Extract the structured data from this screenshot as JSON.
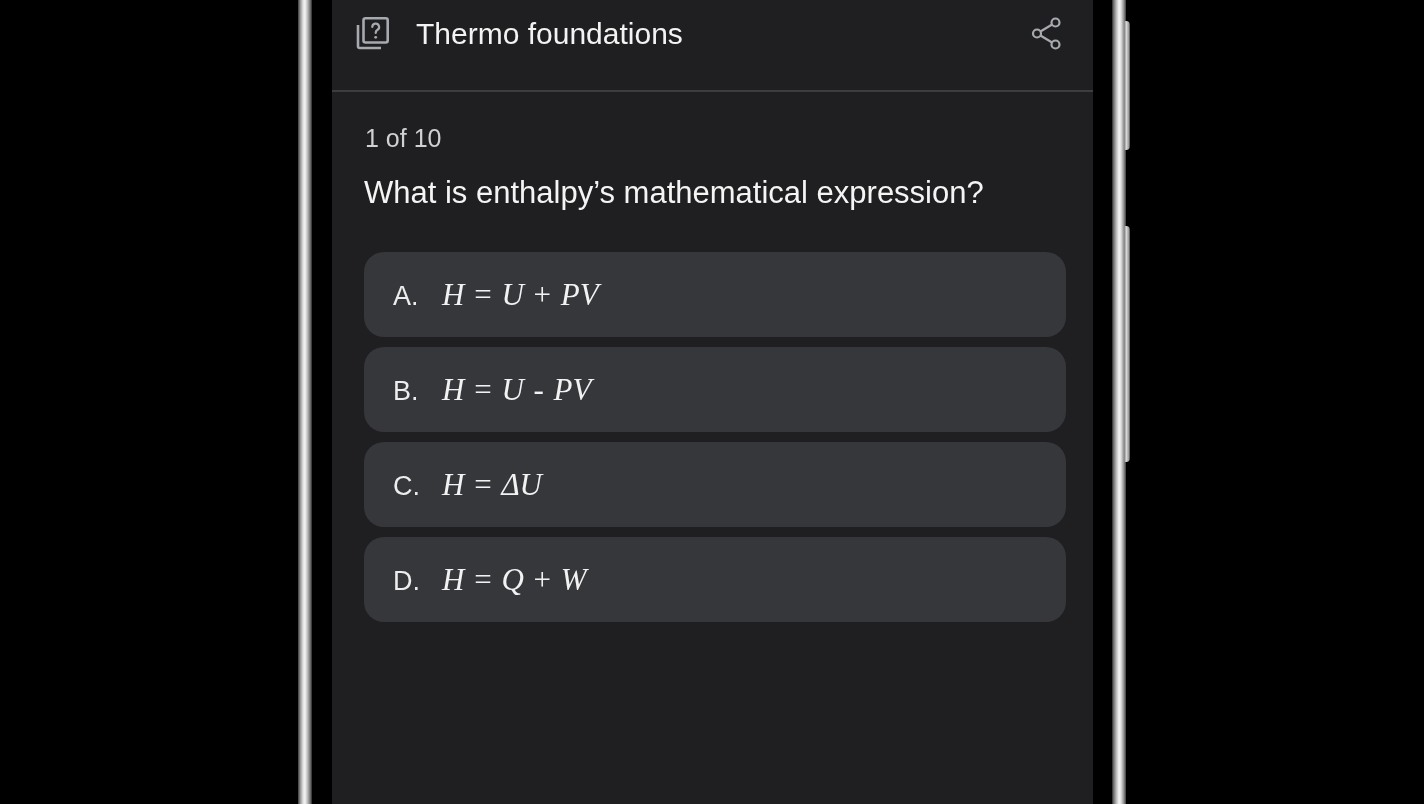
{
  "header": {
    "title": "Thermo foundations"
  },
  "progress": "1 of 10",
  "question": "What is enthalpy’s mathematical expression?",
  "options": [
    {
      "letter": "A.",
      "answer": "*H* = *U* + *PV*",
      "selected": false
    },
    {
      "letter": "B.",
      "answer": "*H* = *U* - *PV*",
      "selected": false
    },
    {
      "letter": "C.",
      "answer": "*H* = *ΔU*",
      "selected": false
    },
    {
      "letter": "D.",
      "answer": "*H* = *Q* + *W*",
      "selected": false
    }
  ]
}
